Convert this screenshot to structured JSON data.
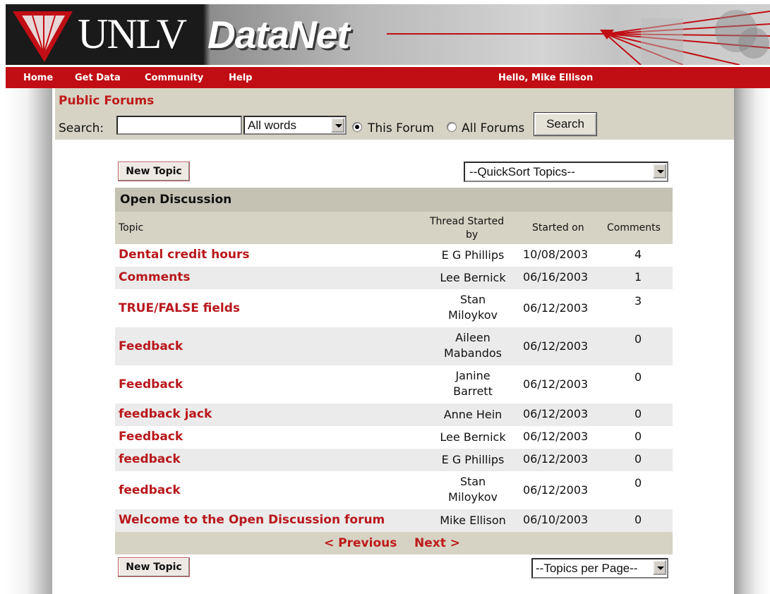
{
  "banner": {
    "unlv": "UNLV",
    "datanet": "DataNet"
  },
  "nav": {
    "items": [
      "Home",
      "Get Data",
      "Community",
      "Help"
    ],
    "greeting": "Hello, Mike Ellison"
  },
  "forum": {
    "title": "Public Forums"
  },
  "search": {
    "label": "Search:",
    "value": "",
    "match_selected": "All words",
    "radio_this": "This Forum",
    "radio_all": "All Forums",
    "radio_checked": "this_forum",
    "button": "Search"
  },
  "toolbar": {
    "new_topic": "New Topic",
    "quicksort": "--QuickSort Topics--",
    "per_page": "--Topics per Page--"
  },
  "table": {
    "section": "Open Discussion",
    "headers": {
      "topic": "Topic",
      "started_by_line1": "Thread Started",
      "started_by_line2": "by",
      "started_on": "Started on",
      "comments": "Comments"
    },
    "rows": [
      {
        "topic": "Dental credit hours",
        "author_line1": "E G Phillips",
        "author_line2": "",
        "date": "10/08/2003",
        "comments": "4"
      },
      {
        "topic": "Comments",
        "author_line1": "Lee Bernick",
        "author_line2": "",
        "date": "06/16/2003",
        "comments": "1"
      },
      {
        "topic": "TRUE/FALSE fields",
        "author_line1": "Stan",
        "author_line2": "Miloykov",
        "date": "06/12/2003",
        "comments": "3"
      },
      {
        "topic": "Feedback",
        "author_line1": "Aileen",
        "author_line2": "Mabandos",
        "date": "06/12/2003",
        "comments": "0"
      },
      {
        "topic": "Feedback",
        "author_line1": "Janine",
        "author_line2": "Barrett",
        "date": "06/12/2003",
        "comments": "0"
      },
      {
        "topic": "feedback jack",
        "author_line1": "Anne Hein",
        "author_line2": "",
        "date": "06/12/2003",
        "comments": "0"
      },
      {
        "topic": "Feedback",
        "author_line1": "Lee Bernick",
        "author_line2": "",
        "date": "06/12/2003",
        "comments": "0"
      },
      {
        "topic": "feedback",
        "author_line1": "E G Phillips",
        "author_line2": "",
        "date": "06/12/2003",
        "comments": "0"
      },
      {
        "topic": "feedback",
        "author_line1": "Stan",
        "author_line2": "Miloykov",
        "date": "06/12/2003",
        "comments": "0"
      },
      {
        "topic": "Welcome to the Open Discussion forum",
        "author_line1": "Mike Ellison",
        "author_line2": "",
        "date": "06/10/2003",
        "comments": "0"
      }
    ],
    "pager": {
      "previous": "< Previous",
      "next": "Next >"
    }
  },
  "colors": {
    "brand_red": "#c10e14",
    "link_red": "#b8181c",
    "header_tan": "#d6d3c4",
    "section_tan": "#c5c2b3"
  }
}
